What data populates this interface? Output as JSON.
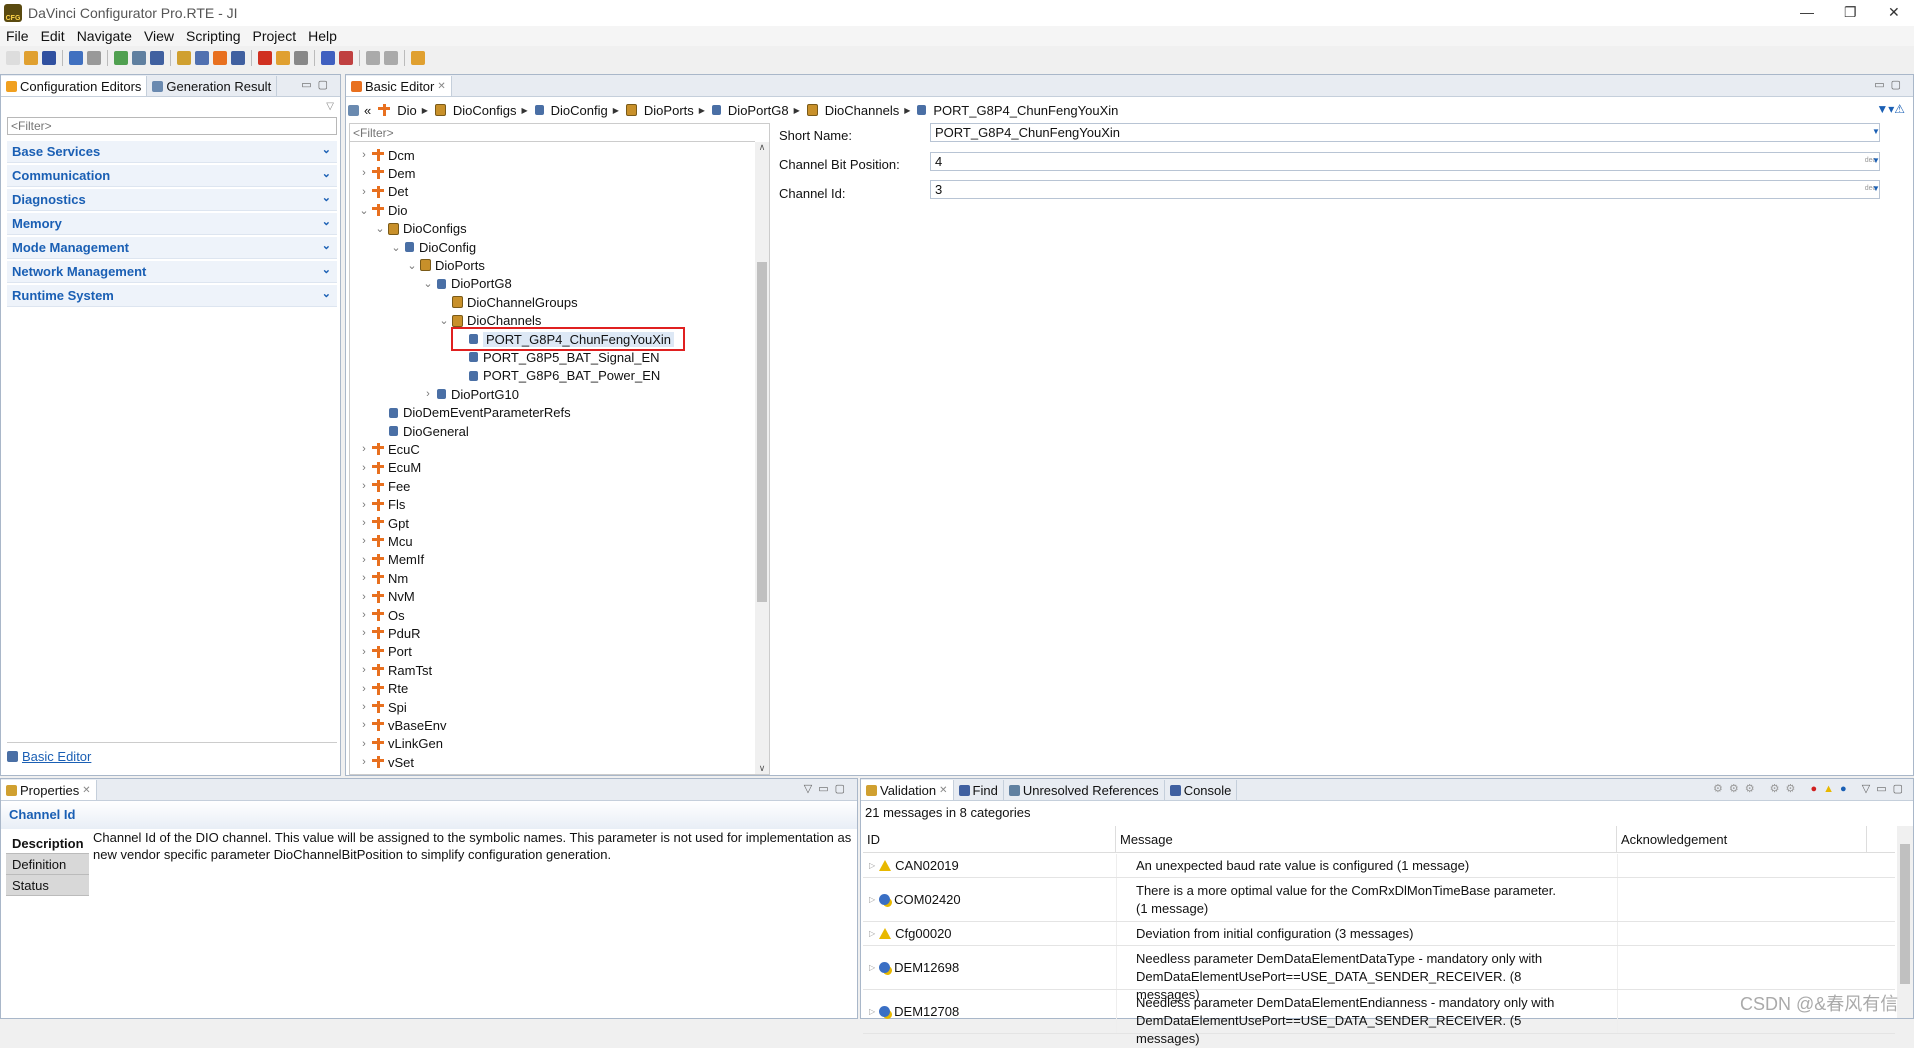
{
  "window": {
    "title": "DaVinci Configurator Pro.RTE - JI",
    "logo_text": "CFG"
  },
  "menu": [
    "File",
    "Edit",
    "Navigate",
    "View",
    "Scripting",
    "Project",
    "Help"
  ],
  "left_panel": {
    "tabs": [
      "Configuration Editors",
      "Generation Result"
    ],
    "filter_placeholder": "<Filter>",
    "categories": [
      "Base Services",
      "Communication",
      "Diagnostics",
      "Memory",
      "Mode Management",
      "Network Management",
      "Runtime System"
    ],
    "footer_link": "Basic Editor"
  },
  "editor": {
    "tab": "Basic Editor",
    "breadcrumb": [
      "Dio",
      "DioConfigs",
      "DioConfig",
      "DioPorts",
      "DioPortG8",
      "DioChannels",
      "PORT_G8P4_ChunFengYouXin"
    ],
    "tree_filter_placeholder": "<Filter>",
    "tree": [
      {
        "label": "Dcm",
        "level": 0,
        "toggle": "collapsed",
        "icon": "module"
      },
      {
        "label": "Dem",
        "level": 0,
        "toggle": "collapsed",
        "icon": "module"
      },
      {
        "label": "Det",
        "level": 0,
        "toggle": "collapsed",
        "icon": "module"
      },
      {
        "label": "Dio",
        "level": 0,
        "toggle": "expanded",
        "icon": "module"
      },
      {
        "label": "DioConfigs",
        "level": 1,
        "toggle": "expanded",
        "icon": "container"
      },
      {
        "label": "DioConfig",
        "level": 2,
        "toggle": "expanded",
        "icon": "object"
      },
      {
        "label": "DioPorts",
        "level": 3,
        "toggle": "expanded",
        "icon": "container"
      },
      {
        "label": "DioPortG8",
        "level": 4,
        "toggle": "expanded",
        "icon": "object"
      },
      {
        "label": "DioChannelGroups",
        "level": 5,
        "toggle": "none",
        "icon": "container"
      },
      {
        "label": "DioChannels",
        "level": 5,
        "toggle": "expanded",
        "icon": "container"
      },
      {
        "label": "PORT_G8P4_ChunFengYouXin",
        "level": 6,
        "toggle": "none",
        "icon": "object",
        "selected": true
      },
      {
        "label": "PORT_G8P5_BAT_Signal_EN",
        "level": 6,
        "toggle": "none",
        "icon": "object"
      },
      {
        "label": "PORT_G8P6_BAT_Power_EN",
        "level": 6,
        "toggle": "none",
        "icon": "object"
      },
      {
        "label": "DioPortG10",
        "level": 4,
        "toggle": "collapsed",
        "icon": "object"
      },
      {
        "label": "DioDemEventParameterRefs",
        "level": 1,
        "toggle": "none",
        "icon": "object"
      },
      {
        "label": "DioGeneral",
        "level": 1,
        "toggle": "none",
        "icon": "object"
      },
      {
        "label": "EcuC",
        "level": 0,
        "toggle": "collapsed",
        "icon": "module"
      },
      {
        "label": "EcuM",
        "level": 0,
        "toggle": "collapsed",
        "icon": "module"
      },
      {
        "label": "Fee",
        "level": 0,
        "toggle": "collapsed",
        "icon": "module"
      },
      {
        "label": "Fls",
        "level": 0,
        "toggle": "collapsed",
        "icon": "module"
      },
      {
        "label": "Gpt",
        "level": 0,
        "toggle": "collapsed",
        "icon": "module"
      },
      {
        "label": "Mcu",
        "level": 0,
        "toggle": "collapsed",
        "icon": "module"
      },
      {
        "label": "MemIf",
        "level": 0,
        "toggle": "collapsed",
        "icon": "module"
      },
      {
        "label": "Nm",
        "level": 0,
        "toggle": "collapsed",
        "icon": "module"
      },
      {
        "label": "NvM",
        "level": 0,
        "toggle": "collapsed",
        "icon": "module"
      },
      {
        "label": "Os",
        "level": 0,
        "toggle": "collapsed",
        "icon": "module"
      },
      {
        "label": "PduR",
        "level": 0,
        "toggle": "collapsed",
        "icon": "module"
      },
      {
        "label": "Port",
        "level": 0,
        "toggle": "collapsed",
        "icon": "module"
      },
      {
        "label": "RamTst",
        "level": 0,
        "toggle": "collapsed",
        "icon": "module"
      },
      {
        "label": "Rte",
        "level": 0,
        "toggle": "collapsed",
        "icon": "module"
      },
      {
        "label": "Spi",
        "level": 0,
        "toggle": "collapsed",
        "icon": "module"
      },
      {
        "label": "vBaseEnv",
        "level": 0,
        "toggle": "collapsed",
        "icon": "module"
      },
      {
        "label": "vLinkGen",
        "level": 0,
        "toggle": "collapsed",
        "icon": "module"
      },
      {
        "label": "vSet",
        "level": 0,
        "toggle": "collapsed",
        "icon": "module"
      }
    ],
    "form": {
      "short_name": {
        "label": "Short Name:",
        "value": "PORT_G8P4_ChunFengYouXin"
      },
      "bit_position": {
        "label": "Channel Bit Position:",
        "value": "4",
        "unit": "dec"
      },
      "channel_id": {
        "label": "Channel Id:",
        "value": "3",
        "unit": "dec"
      }
    },
    "highlight_color": "#e02020"
  },
  "properties": {
    "tab": "Properties",
    "title": "Channel Id",
    "side_tabs": [
      "Description",
      "Definition",
      "Status"
    ],
    "description": "Channel Id of the DIO channel. This value will be assigned to the symbolic names. This parameter is not used for implementation as new vendor specific parameter DioChannelBitPosition to simplify configuration generation."
  },
  "validation": {
    "tabs": [
      "Validation",
      "Find",
      "Unresolved References",
      "Console"
    ],
    "summary": "21 messages in 8 categories",
    "columns": [
      "ID",
      "Message",
      "Acknowledgement"
    ],
    "rows": [
      {
        "id": "CAN02019",
        "severity": "warning",
        "message": "An unexpected baud rate value is configured (1 message)"
      },
      {
        "id": "COM02420",
        "severity": "info",
        "message": "There is a more optimal value for the ComRxDlMonTimeBase parameter. (1 message)"
      },
      {
        "id": "Cfg00020",
        "severity": "warning",
        "message": "Deviation from initial configuration (3 messages)"
      },
      {
        "id": "DEM12698",
        "severity": "info",
        "message": "Needless parameter DemDataElementDataType - mandatory only with DemDataElementUsePort==USE_DATA_SENDER_RECEIVER. (8 messages)"
      },
      {
        "id": "DEM12708",
        "severity": "info",
        "message": "Needless parameter DemDataElementEndianness - mandatory only with DemDataElementUsePort==USE_DATA_SENDER_RECEIVER. (5 messages)"
      }
    ]
  },
  "watermark": "CSDN @&春风有信"
}
